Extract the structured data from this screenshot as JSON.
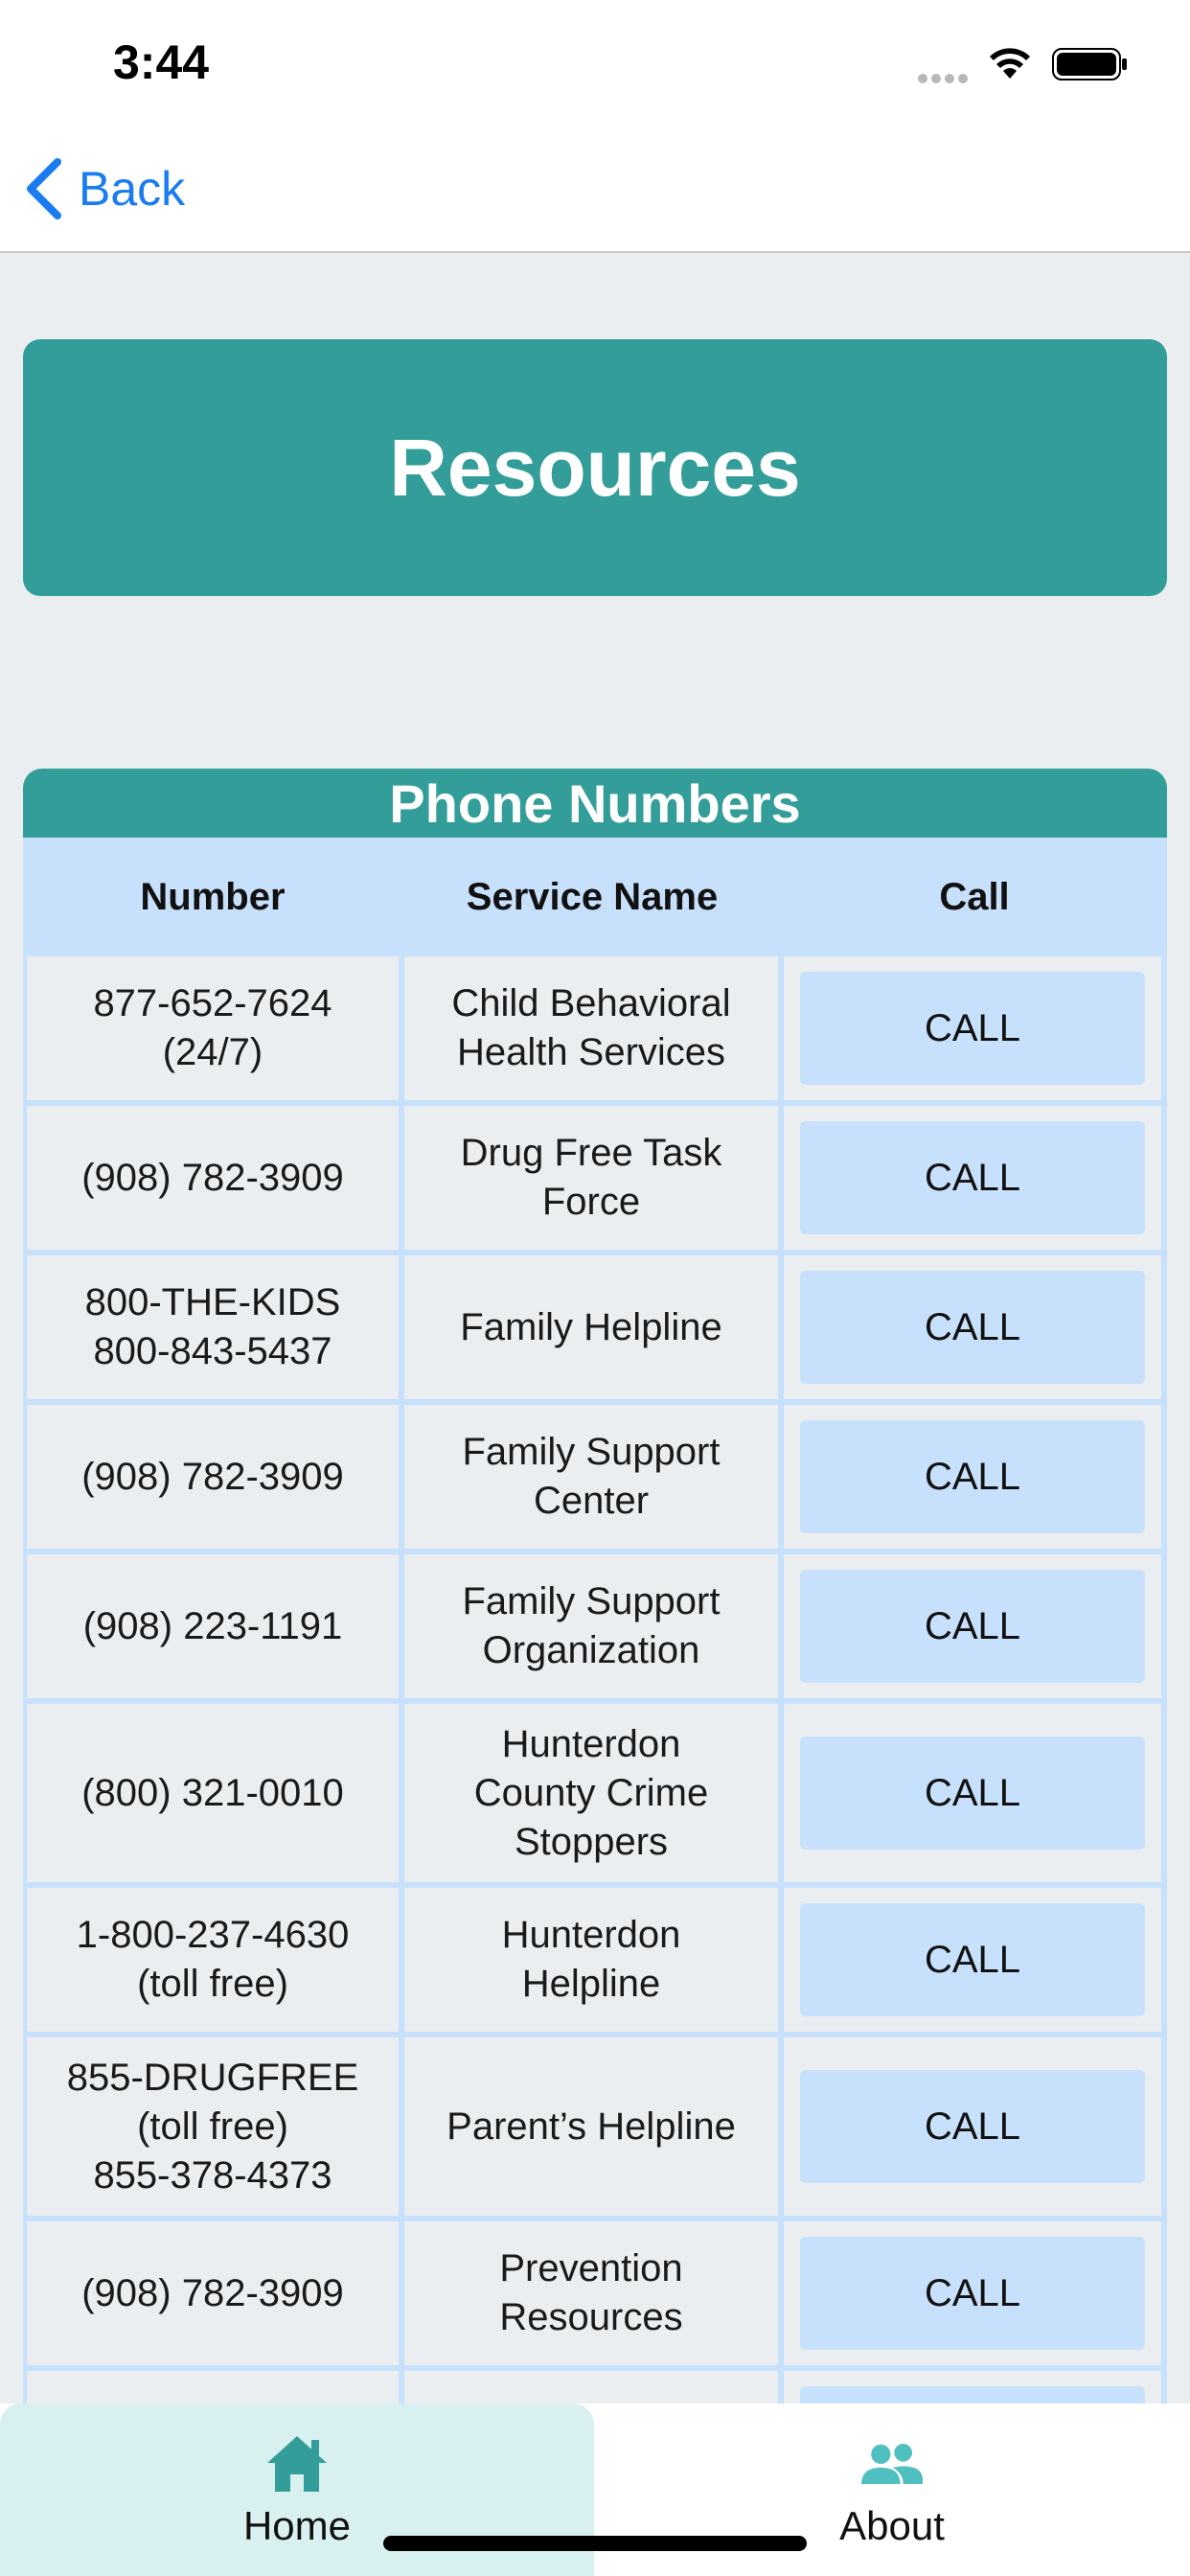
{
  "status_bar": {
    "time": "3:44"
  },
  "nav": {
    "back_label": "Back"
  },
  "banner": {
    "title": "Resources"
  },
  "phone_section": {
    "title": "Phone Numbers",
    "columns": [
      "Number",
      "Service Name",
      "Call"
    ],
    "rows": [
      {
        "number": "877-652-7624\n(24/7)",
        "service": "Child Behavioral\nHealth Services",
        "action": "CALL"
      },
      {
        "number": "(908) 782-3909",
        "service": "Drug Free Task\nForce",
        "action": "CALL"
      },
      {
        "number": "800-THE-KIDS\n800-843-5437",
        "service": "Family Helpline",
        "action": "CALL"
      },
      {
        "number": "(908) 782-3909",
        "service": "Family Support\nCenter",
        "action": "CALL"
      },
      {
        "number": "(908) 223-1191",
        "service": "Family Support\nOrganization",
        "action": "CALL"
      },
      {
        "number": "(800) 321-0010",
        "service": "Hunterdon\nCounty Crime\nStoppers",
        "action": "CALL"
      },
      {
        "number": "1-800-237-4630\n(toll free)",
        "service": "Hunterdon\nHelpline",
        "action": "CALL"
      },
      {
        "number": "855-DRUGFREE\n(toll free)\n855-378-4373",
        "service": "Parent’s Helpline",
        "action": "CALL"
      },
      {
        "number": "(908) 782-3909",
        "service": "Prevention\nResources",
        "action": "CALL"
      }
    ]
  },
  "tabs": [
    {
      "label": "Home",
      "icon": "home-icon",
      "selected": true
    },
    {
      "label": "About",
      "icon": "people-icon",
      "selected": false
    }
  ],
  "colors": {
    "accent": "#339e99",
    "link": "#1a7cf0",
    "table_blue": "#c7e0fb",
    "background": "#eaeef0"
  }
}
